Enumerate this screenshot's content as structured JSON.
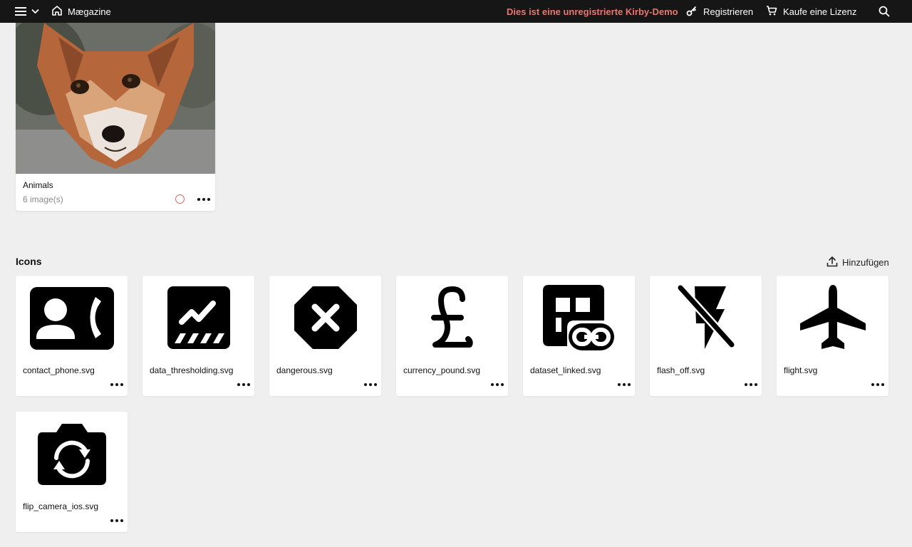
{
  "topbar": {
    "app_name": "Mægazine",
    "demo_notice": "Dies ist eine unregistrierte Kirby-Demo",
    "register_label": "Registrieren",
    "buy_label": "Kaufe eine Lizenz",
    "icons": [
      "menu-icon",
      "chevron-down-icon",
      "home-icon",
      "key-icon",
      "cart-icon",
      "search-icon"
    ],
    "accent_color": "#e8776e",
    "background": "#161616"
  },
  "album": {
    "title": "Animals",
    "subtitle": "6 image(s)",
    "status_color": "#c96a62"
  },
  "icons_section": {
    "title": "Icons",
    "add_label": "Hinzufügen",
    "files": [
      {
        "name": "contact_phone.svg",
        "icon": "contact-phone-icon"
      },
      {
        "name": "data_thresholding.svg",
        "icon": "data-thresholding-icon"
      },
      {
        "name": "dangerous.svg",
        "icon": "dangerous-icon"
      },
      {
        "name": "currency_pound.svg",
        "icon": "currency-pound-icon"
      },
      {
        "name": "dataset_linked.svg",
        "icon": "dataset-linked-icon"
      },
      {
        "name": "flash_off.svg",
        "icon": "flash-off-icon"
      },
      {
        "name": "flight.svg",
        "icon": "flight-icon"
      },
      {
        "name": "flip_camera_ios.svg",
        "icon": "flip-camera-ios-icon"
      }
    ]
  }
}
